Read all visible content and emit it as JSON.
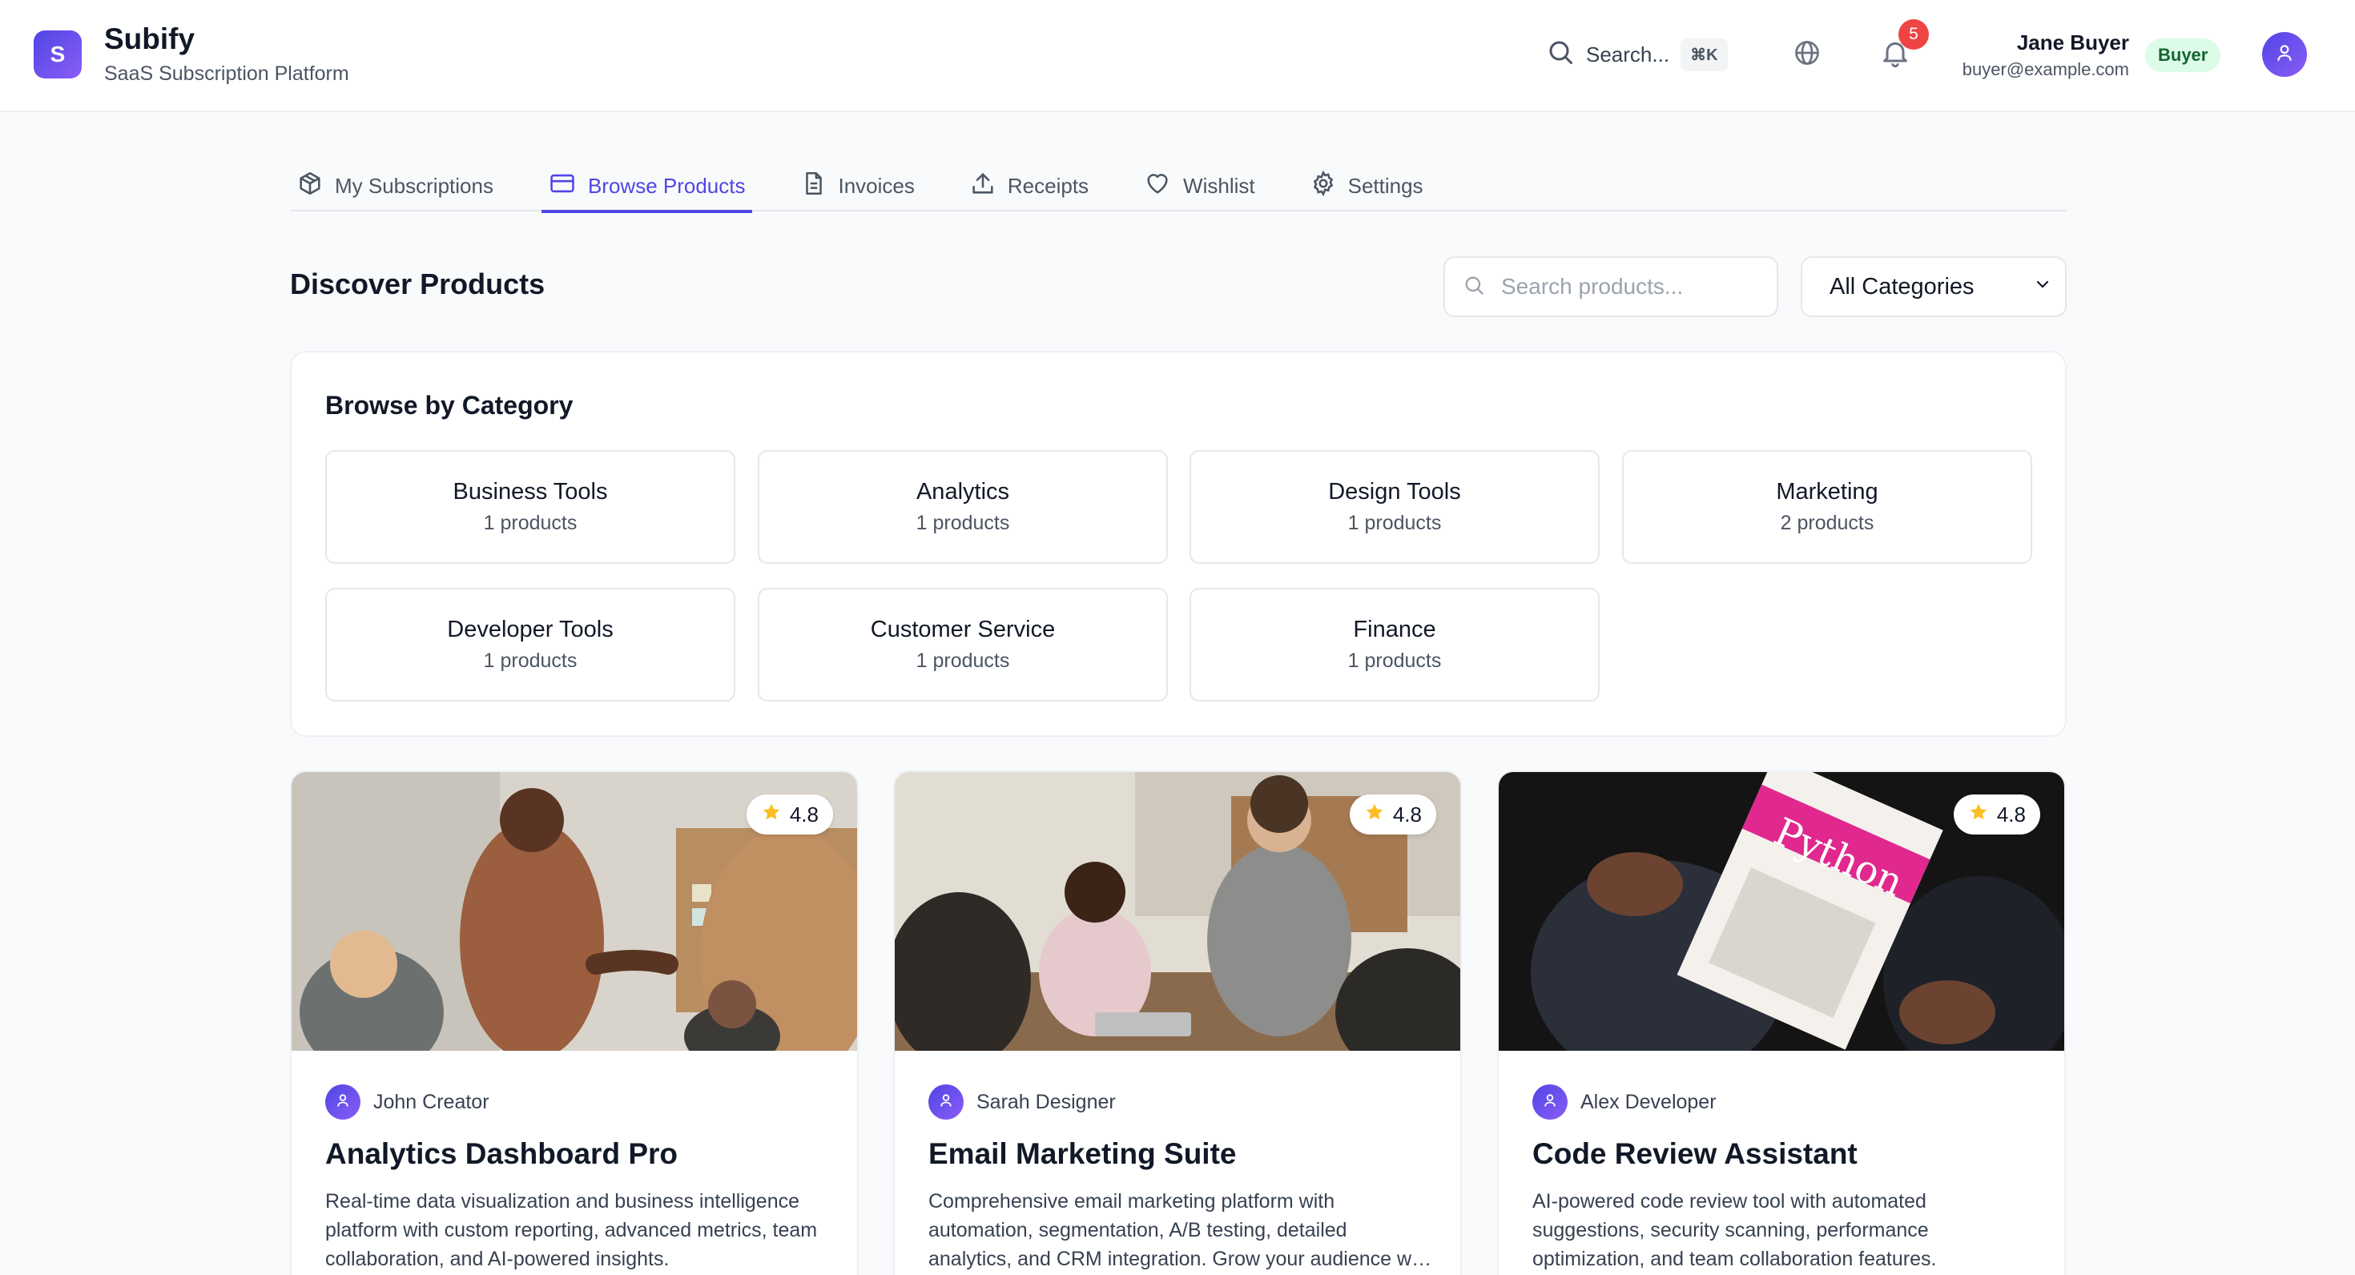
{
  "app": {
    "logo_letter": "S",
    "name": "Subify",
    "subtitle": "SaaS Subscription Platform"
  },
  "header": {
    "search_label": "Search...",
    "search_shortcut": "⌘K",
    "notification_count": "5",
    "user": {
      "name": "Jane Buyer",
      "email": "buyer@example.com",
      "role": "Buyer"
    }
  },
  "tabs": [
    {
      "label": "My Subscriptions",
      "icon": "package-icon",
      "active": false
    },
    {
      "label": "Browse Products",
      "icon": "card-icon",
      "active": true
    },
    {
      "label": "Invoices",
      "icon": "document-icon",
      "active": false
    },
    {
      "label": "Receipts",
      "icon": "upload-icon",
      "active": false
    },
    {
      "label": "Wishlist",
      "icon": "heart-icon",
      "active": false
    },
    {
      "label": "Settings",
      "icon": "gear-icon",
      "active": false
    }
  ],
  "discover": {
    "title": "Discover Products",
    "search_placeholder": "Search products...",
    "category_filter": "All Categories"
  },
  "categories": {
    "title": "Browse by Category",
    "items": [
      {
        "name": "Business Tools",
        "count": "1 products"
      },
      {
        "name": "Analytics",
        "count": "1 products"
      },
      {
        "name": "Design Tools",
        "count": "1 products"
      },
      {
        "name": "Marketing",
        "count": "2 products"
      },
      {
        "name": "Developer Tools",
        "count": "1 products"
      },
      {
        "name": "Customer Service",
        "count": "1 products"
      },
      {
        "name": "Finance",
        "count": "1 products"
      }
    ]
  },
  "products": [
    {
      "rating": "4.8",
      "creator": "John Creator",
      "title": "Analytics Dashboard Pro",
      "description": "Real-time data visualization and business intelligence platform with custom reporting, advanced metrics, team collaboration, and AI-powered insights."
    },
    {
      "rating": "4.8",
      "creator": "Sarah Designer",
      "title": "Email Marketing Suite",
      "description": "Comprehensive email marketing platform with automation, segmentation, A/B testing, detailed analytics, and CRM integration. Grow your audience with targeted campaigns."
    },
    {
      "rating": "4.8",
      "creator": "Alex Developer",
      "title": "Code Review Assistant",
      "description": "AI-powered code review tool with automated suggestions, security scanning, performance optimization, and team collaboration features."
    }
  ],
  "colors": {
    "accent": "#4f46e5",
    "badge_red": "#ef4444",
    "role_badge_bg": "#dcfce7",
    "role_badge_text": "#166534",
    "star": "#fbbf24"
  }
}
